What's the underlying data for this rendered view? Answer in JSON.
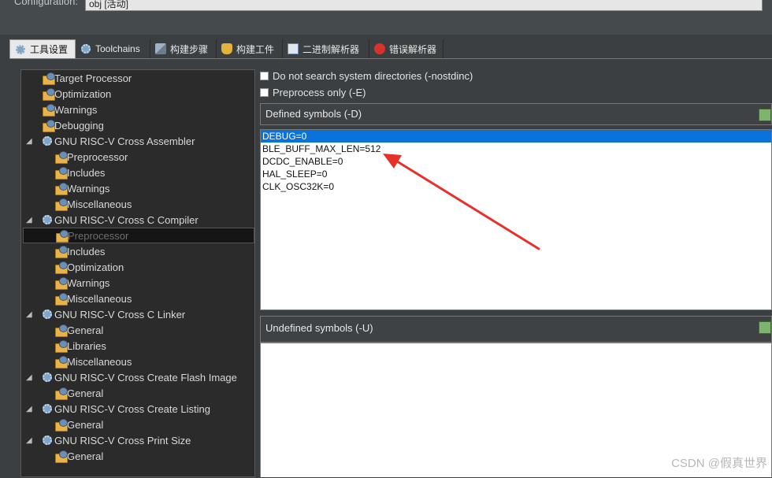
{
  "top": {
    "configuration_label": "Configuration:",
    "configuration_value": "obj [活动]"
  },
  "tabs": [
    {
      "label": "工具设置",
      "icon": "gear-icon",
      "active": true
    },
    {
      "label": "Toolchains",
      "icon": "gear-icon",
      "active": false
    },
    {
      "label": "构建步骤",
      "icon": "build-steps-icon",
      "active": false
    },
    {
      "label": "构建工件",
      "icon": "trophy-icon",
      "active": false
    },
    {
      "label": "二进制解析器",
      "icon": "binary-icon",
      "active": false
    },
    {
      "label": "错误解析器",
      "icon": "error-icon",
      "active": false
    }
  ],
  "tree": {
    "items": [
      {
        "label": "Target Processor",
        "level": 1,
        "icon": "folder-icon"
      },
      {
        "label": "Optimization",
        "level": 1,
        "icon": "folder-icon"
      },
      {
        "label": "Warnings",
        "level": 1,
        "icon": "folder-icon"
      },
      {
        "label": "Debugging",
        "level": 1,
        "icon": "folder-icon"
      },
      {
        "label": "GNU RISC-V Cross Assembler",
        "level": 0,
        "icon": "gear-icon",
        "expanded": true
      },
      {
        "label": "Preprocessor",
        "level": 2,
        "icon": "folder-icon"
      },
      {
        "label": "Includes",
        "level": 2,
        "icon": "folder-icon"
      },
      {
        "label": "Warnings",
        "level": 2,
        "icon": "folder-icon"
      },
      {
        "label": "Miscellaneous",
        "level": 2,
        "icon": "folder-icon"
      },
      {
        "label": "GNU RISC-V Cross C Compiler",
        "level": 0,
        "icon": "gear-icon",
        "expanded": true
      },
      {
        "label": "Preprocessor",
        "level": 2,
        "icon": "folder-icon",
        "selected": true
      },
      {
        "label": "Includes",
        "level": 2,
        "icon": "folder-icon"
      },
      {
        "label": "Optimization",
        "level": 2,
        "icon": "folder-icon"
      },
      {
        "label": "Warnings",
        "level": 2,
        "icon": "folder-icon"
      },
      {
        "label": "Miscellaneous",
        "level": 2,
        "icon": "folder-icon"
      },
      {
        "label": "GNU RISC-V Cross C Linker",
        "level": 0,
        "icon": "gear-icon",
        "expanded": true
      },
      {
        "label": "General",
        "level": 2,
        "icon": "folder-icon"
      },
      {
        "label": "Libraries",
        "level": 2,
        "icon": "folder-icon"
      },
      {
        "label": "Miscellaneous",
        "level": 2,
        "icon": "folder-icon"
      },
      {
        "label": "GNU RISC-V Cross Create Flash Image",
        "level": 0,
        "icon": "gear-icon",
        "expanded": true
      },
      {
        "label": "General",
        "level": 2,
        "icon": "folder-icon"
      },
      {
        "label": "GNU RISC-V Cross Create Listing",
        "level": 0,
        "icon": "gear-icon",
        "expanded": true
      },
      {
        "label": "General",
        "level": 2,
        "icon": "folder-icon"
      },
      {
        "label": "GNU RISC-V Cross Print Size",
        "level": 0,
        "icon": "gear-icon",
        "expanded": true
      },
      {
        "label": "General",
        "level": 2,
        "icon": "folder-icon"
      }
    ]
  },
  "options": {
    "nostdinc_label": "Do not search system directories (-nostdinc)",
    "preprocess_only_label": "Preprocess only (-E)"
  },
  "defined": {
    "title": "Defined symbols (-D)",
    "items": [
      "DEBUG=0",
      "BLE_BUFF_MAX_LEN=512",
      "DCDC_ENABLE=0",
      "HAL_SLEEP=0",
      "CLK_OSC32K=0"
    ],
    "selected_index": 0
  },
  "undefined": {
    "title": "Undefined symbols (-U)",
    "items": []
  },
  "watermark": "CSDN @假真世界",
  "colors": {
    "selection": "#0a72d8",
    "annotation_arrow": "#e8302a",
    "background": "#3c3f41"
  }
}
